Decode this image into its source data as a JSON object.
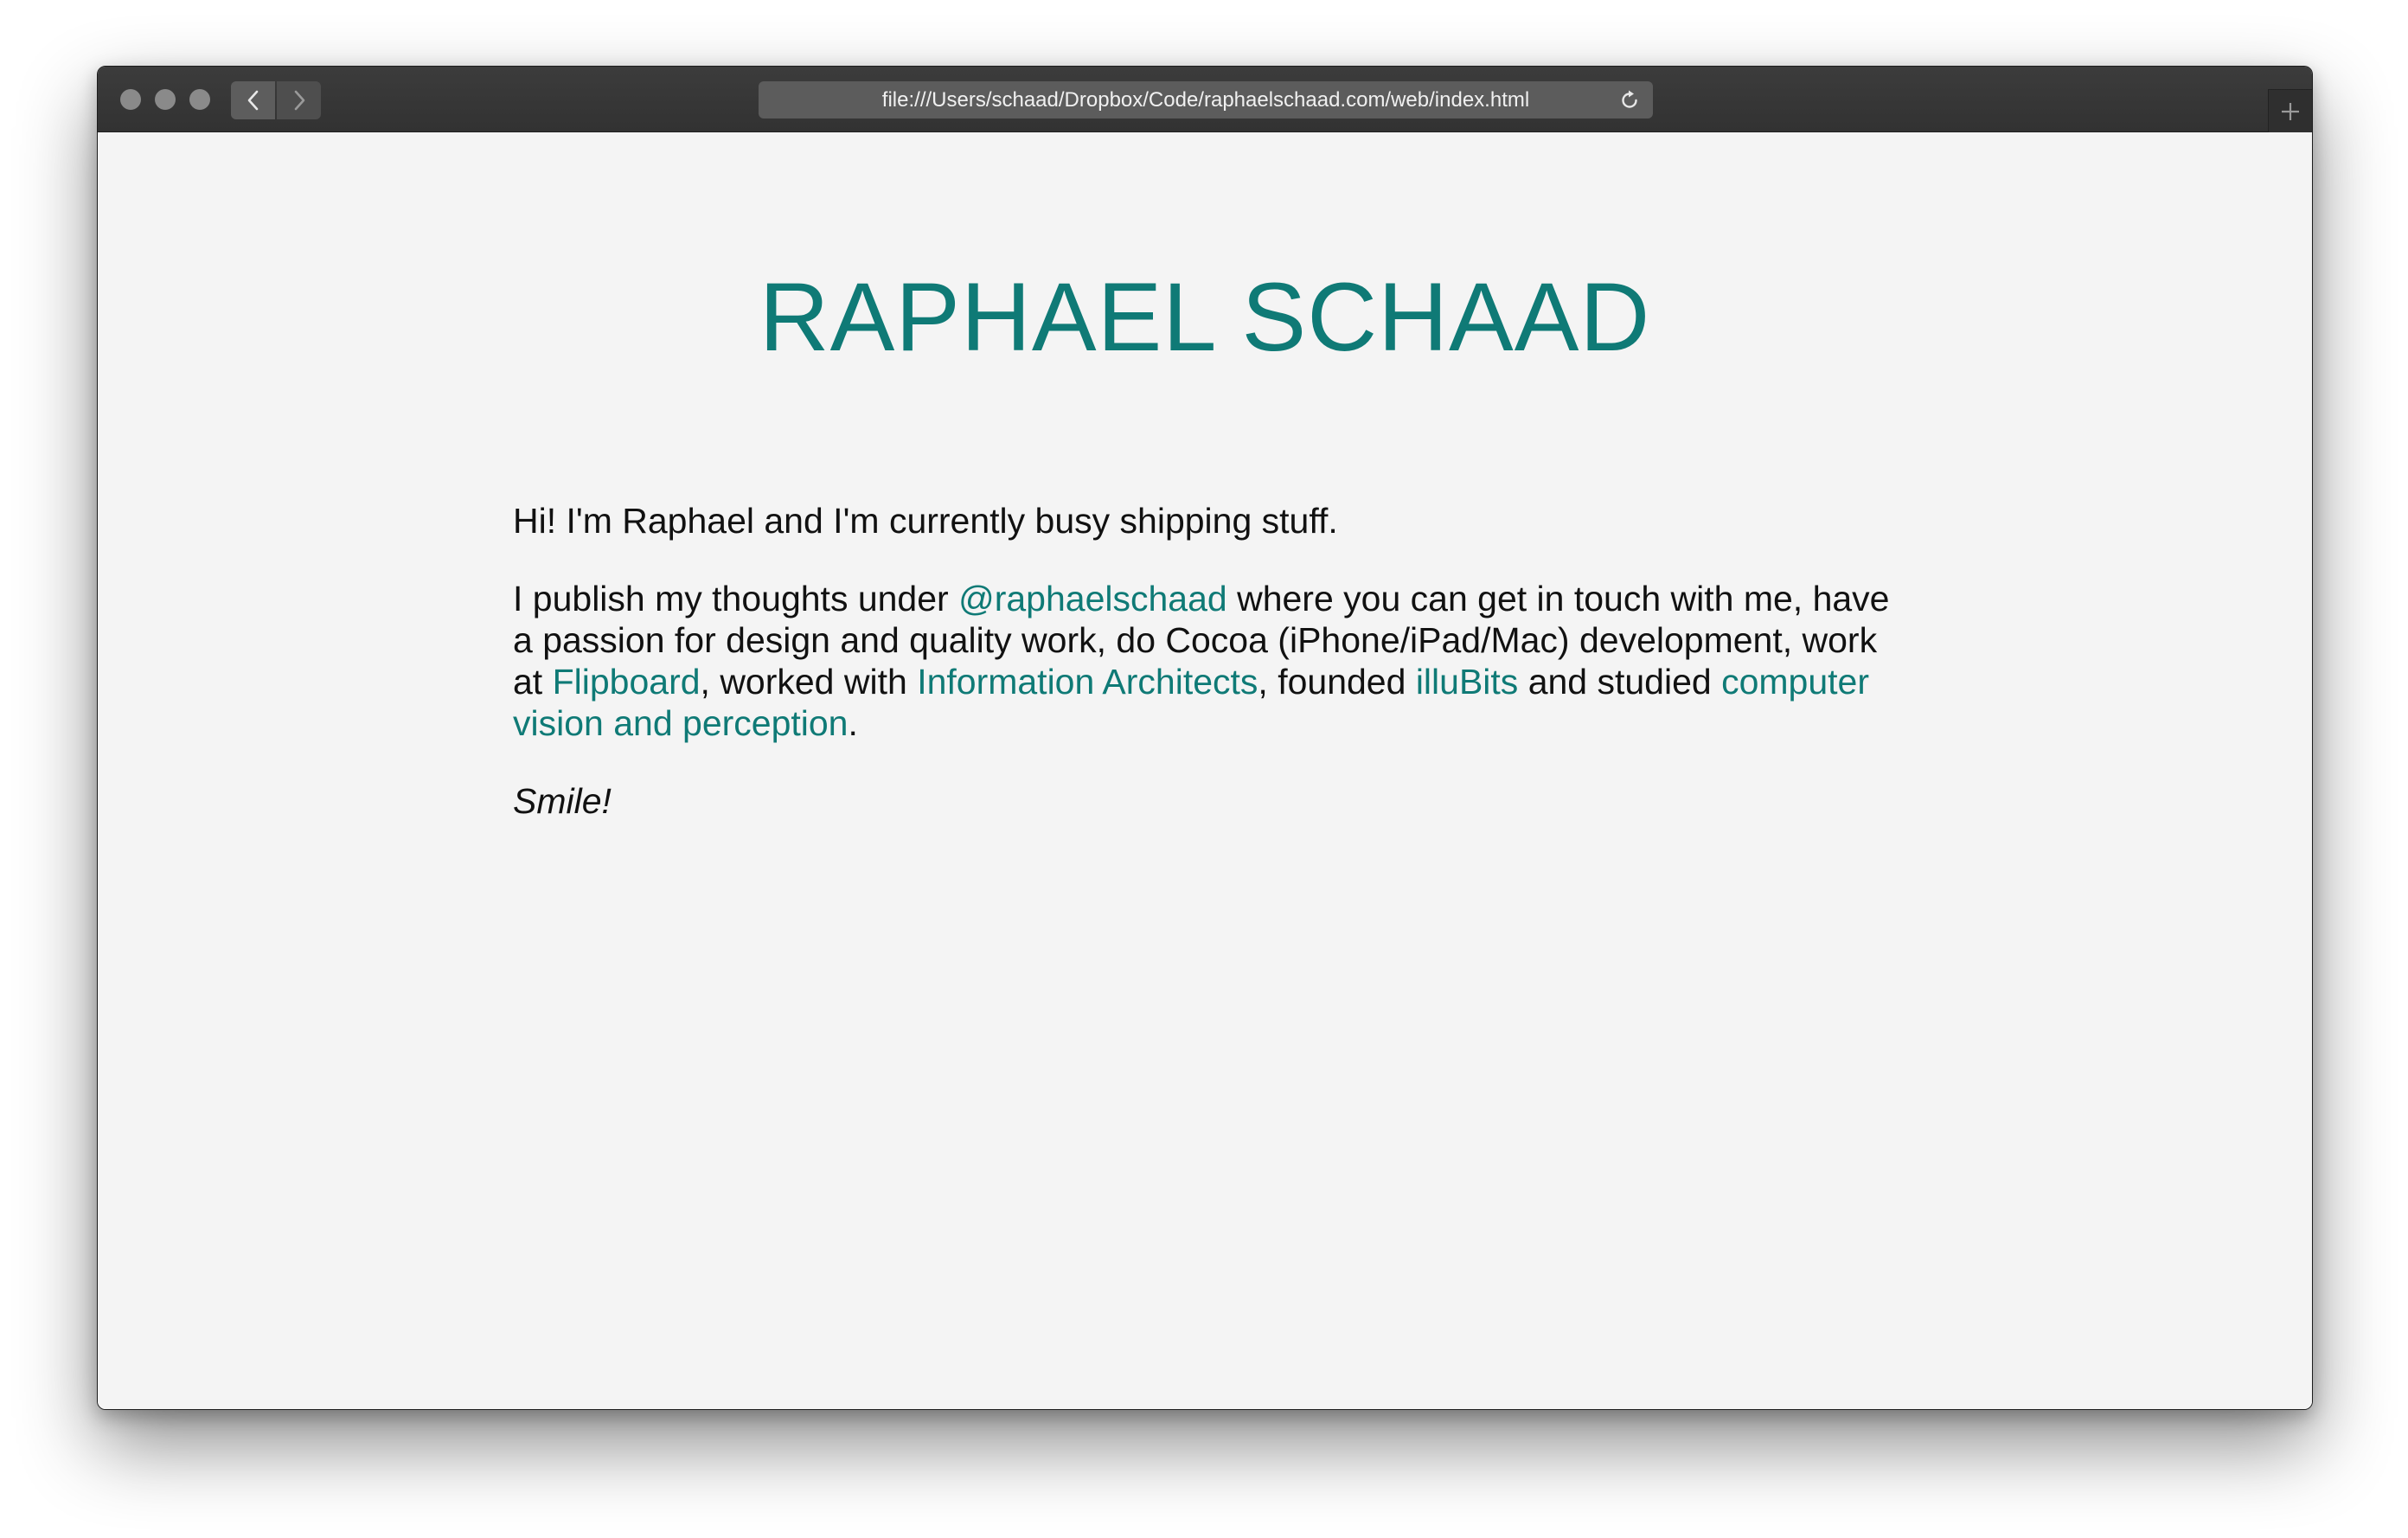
{
  "browser": {
    "url": "file:///Users/schaad/Dropbox/Code/raphaelschaad.com/web/index.html"
  },
  "page": {
    "title": "RAPHAEL SCHAAD",
    "intro": "Hi! I'm Raphael and I'm currently busy shipping stuff.",
    "bio": {
      "part1": "I publish my thoughts under ",
      "link_twitter": "@raphaelschaad",
      "part2": " where you can get in touch with me, have a passion for design and quality work, do Cocoa (iPhone/iPad/Mac) development, work at ",
      "link_flipboard": "Flipboard",
      "part3": ", worked with ",
      "link_ia": "Information Architects",
      "part4": ", founded ",
      "link_illubits": "illuBits",
      "part5": " and studied ",
      "link_cv": "computer vision and perception",
      "part6": "."
    },
    "closing": "Smile!"
  },
  "colors": {
    "accent": "#0f7a76",
    "text": "#111111",
    "background": "#f4f4f4",
    "titlebar": "#363636"
  },
  "icons": {
    "back": "chevron-left-icon",
    "forward": "chevron-right-icon",
    "reload": "reload-icon",
    "new_tab": "plus-icon"
  }
}
